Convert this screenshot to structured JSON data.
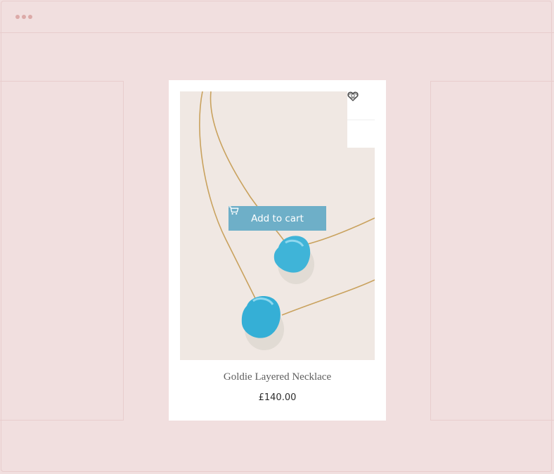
{
  "window": {
    "controls": [
      "dot",
      "dot",
      "dot"
    ]
  },
  "product": {
    "title": "Goldie Layered Necklace",
    "price": "£140.00",
    "add_to_cart_label": "Add to cart",
    "image_subject": "necklace-photo"
  },
  "actions": {
    "quick_view_icon": "eye-icon",
    "wishlist_icon": "heart-icon",
    "cart_icon": "cart-icon"
  },
  "colors": {
    "page_bg": "#f1dfdf",
    "outline": "#e8cdcd",
    "card_bg": "#ffffff",
    "button_bg": "#6eafc8",
    "stone": "#3fb4d8",
    "chain": "#c9a25e"
  }
}
